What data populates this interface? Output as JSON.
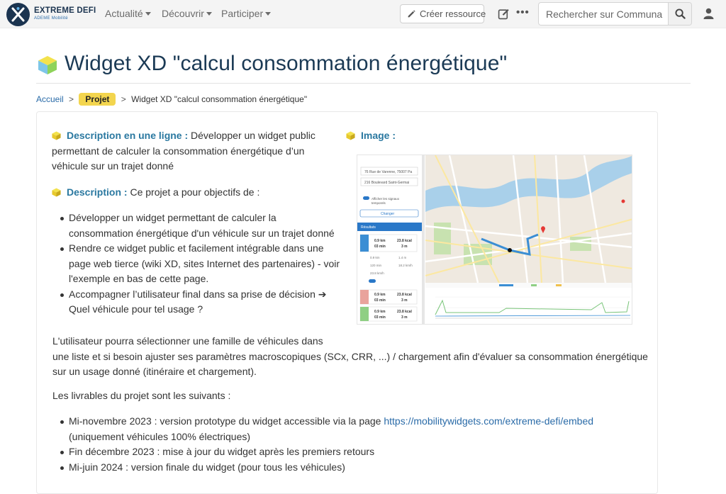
{
  "nav": {
    "brand_name": "EXTREME DEFI",
    "brand_sub": "ADEME Mobilité",
    "menu": [
      {
        "label": "Actualité"
      },
      {
        "label": "Découvrir"
      },
      {
        "label": "Participer"
      }
    ],
    "create_label": "Créer ressource",
    "more_label": "•••",
    "search_placeholder": "Rechercher sur Communa"
  },
  "page": {
    "title": "Widget XD \"calcul consommation énergétique\"",
    "breadcrumb": {
      "home": "Accueil",
      "sep1": ">",
      "badge": "Projet",
      "sep2": ">",
      "current": "Widget XD \"calcul consommation énergétique\""
    }
  },
  "content": {
    "oneline_label": "Description en une ligne :",
    "oneline_line1": " Développer un widget public",
    "oneline_line2": "permettant de calculer la consommation énergétique d’un",
    "oneline_line3": "véhicule sur un trajet donné",
    "desc_label": "Description :",
    "desc_text": " Ce projet a pour objectifs de :",
    "goals": [
      {
        "l1": "Développer un widget permettant de calculer la",
        "l2": "consommation énergétique d'un véhicule sur un trajet donné"
      },
      {
        "l1": "Rendre ce widget public et facilement intégrable dans une",
        "l2": "page web tierce (wiki XD, sites Internet des partenaires) - voir",
        "l3": "l'exemple en bas de cette page."
      },
      {
        "l1": "Accompagner l’utilisateur final dans sa prise de décision ➔",
        "l2": "Quel véhicule pour tel usage ?"
      }
    ],
    "image_label": "Image :",
    "para_line1": "L'utilisateur pourra sélectionner une famille de véhicules dans",
    "para_line2": "une liste et si besoin ajuster ses paramètres macroscopiques (SCx, CRR, ...) / chargement afin d'évaluer sa consommation énergétique",
    "para_line3": "sur un usage donné (itinéraire et chargement).",
    "deliv_intro": "Les livrables du projet sont les suivants :",
    "deliverables": [
      {
        "text": "Mi-novembre 2023 : version prototype du widget accessible via la page ",
        "link": "https://mobilitywidgets.com/extreme-defi/embed",
        "l2": "(uniquement véhicules 100% électriques)"
      },
      {
        "text": "Fin décembre 2023 : mise à jour du widget après les premiers retours"
      },
      {
        "text": "Mi-juin 2024 : version finale du widget (pour tous les véhicules)"
      }
    ]
  },
  "widget": {
    "from": "76 Rue de Varenne, 75007 Pa",
    "to": "216 Boulevard Saint-Germai",
    "toggle_label": "Afficher les signaux",
    "toggle_label2": "temporels",
    "submit": "Changer",
    "results_header": "Résultats",
    "results": [
      {
        "dist": "0.9 km",
        "time": "03 min",
        "energy": "23.8 kcal",
        "cost": "3 m"
      },
      {
        "dist": "0.9 km",
        "time": "03 min",
        "energy": "23.8 kcal",
        "cost": "3 m"
      },
      {
        "dist": "0.9 km",
        "time": "03 min",
        "energy": "23.8 kcal",
        "cost": "3 m"
      }
    ],
    "stats": [
      "0.9 km",
      "1.4 m",
      "120 min",
      "18.2 km/h",
      "23.8 km/h"
    ]
  },
  "colors": {
    "brand": "#1b3450",
    "accent_blue": "#2a78a0",
    "badge_yellow": "#f3d54e",
    "link": "#2a6ba8"
  }
}
